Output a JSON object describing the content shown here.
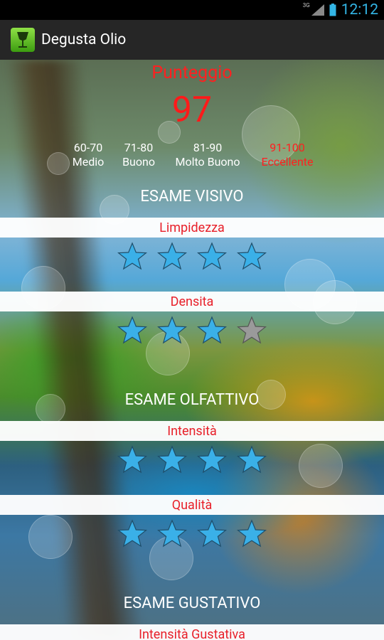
{
  "status_bar": {
    "network": "3G",
    "time": "12:12"
  },
  "app": {
    "title": "Degusta Olio",
    "icon": "wine-glass-icon"
  },
  "score": {
    "title": "Punteggio",
    "value": "97",
    "ranges": [
      {
        "range": "60-70",
        "label": "Medio",
        "active": false
      },
      {
        "range": "71-80",
        "label": "Buono",
        "active": false
      },
      {
        "range": "81-90",
        "label": "Molto Buono",
        "active": false
      },
      {
        "range": "91-100",
        "label": "Eccellente",
        "active": true
      }
    ]
  },
  "sections": {
    "visivo": {
      "title": "ESAME VISIVO",
      "criteria": [
        {
          "label": "Limpidezza",
          "rating": 4,
          "max": 4
        },
        {
          "label": "Densita",
          "rating": 3,
          "max": 4
        }
      ]
    },
    "olfattivo": {
      "title": "ESAME OLFATTIVO",
      "criteria": [
        {
          "label": "Intensità",
          "rating": 4,
          "max": 4
        },
        {
          "label": "Qualità",
          "rating": 4,
          "max": 4
        }
      ]
    },
    "gustativo": {
      "title": "ESAME GUSTATIVO",
      "criteria": [
        {
          "label": "Intensità Gustativa"
        }
      ]
    }
  },
  "colors": {
    "accent_red": "#ff2020",
    "star_on": "#3ab0e8",
    "star_off": "#9a9a9a",
    "clock": "#33b5e5"
  }
}
